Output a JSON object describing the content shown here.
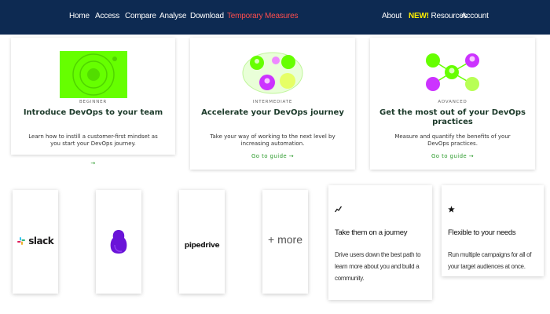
{
  "nav": {
    "left": [
      "Home",
      "Access",
      "Compare",
      "Analyse",
      "Download",
      "Temporary Measures"
    ],
    "about": "About",
    "new_badge": "NEW!",
    "resources": "Resources",
    "account": "Account"
  },
  "guides": [
    {
      "level": "BEGINNER",
      "title": "Introduce DevOps to your team",
      "description": "Learn how to instill a customer-first mindset as you start your DevOps journey.",
      "link": "→"
    },
    {
      "level": "INTERMEDIATE",
      "title": "Accelerate your DevOps journey",
      "description": "Take your way of working to the next level by increasing automation.",
      "link": "Go to guide →"
    },
    {
      "level": "ADVANCED",
      "title": "Get the most out of your DevOps practices",
      "description": "Measure and quantify the benefits of your DevOps practices.",
      "link": "Go to guide →"
    }
  ],
  "integrations": {
    "slack": "slack",
    "pipedrive": "pipedrive",
    "more": "+ more"
  },
  "features": [
    {
      "icon": "trend-icon",
      "title": "Take them on a journey",
      "description": "Drive users down the best path to learn more about you and build a community."
    },
    {
      "icon": "star-icon",
      "title": "Flexible to your needs",
      "description": "Run multiple campaigns for all of your target audiences at once."
    }
  ],
  "colors": {
    "nav_bg": "#0d2a52",
    "temporary_measures": "#ff4d4d",
    "new_badge": "#ffee00",
    "guide_link": "#2a9a2a",
    "illustration_green": "#66ff00",
    "illustration_purple": "#cc33ff"
  }
}
